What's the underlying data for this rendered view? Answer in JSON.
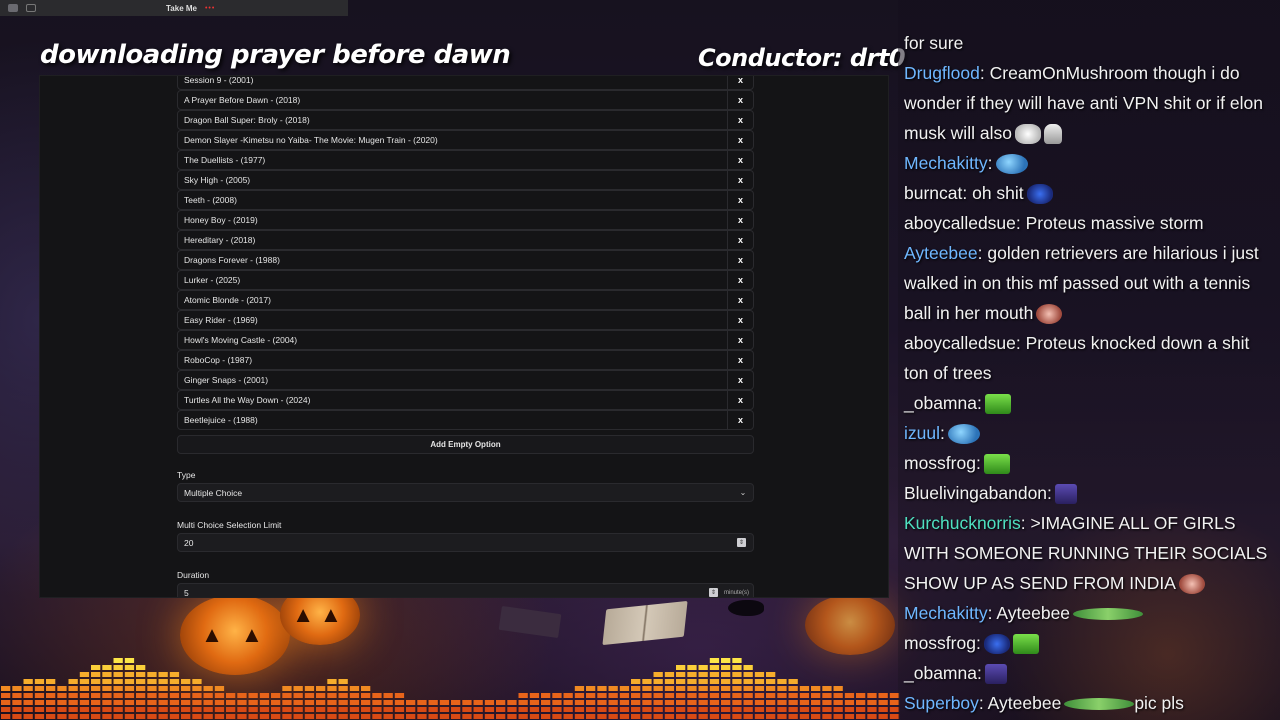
{
  "overlay": {
    "tab_name": "Take Me",
    "tab_dots": "•••",
    "stream_title": "downloading prayer before dawn",
    "conductor": "Conductor: drt0"
  },
  "poll": {
    "options": [
      "Session 9 - (2001)",
      "A Prayer Before Dawn - (2018)",
      "Dragon Ball Super: Broly - (2018)",
      "Demon Slayer -Kimetsu no Yaiba- The Movie: Mugen Train - (2020)",
      "The Duellists - (1977)",
      "Sky High - (2005)",
      "Teeth - (2008)",
      "Honey Boy - (2019)",
      "Hereditary - (2018)",
      "Dragons Forever - (1988)",
      "Lurker - (2025)",
      "Atomic Blonde - (2017)",
      "Easy Rider - (1969)",
      "Howl's Moving Castle - (2004)",
      "RoboCop - (1987)",
      "Ginger Snaps - (2001)",
      "Turtles All the Way Down - (2024)",
      "Beetlejuice - (1988)"
    ],
    "remove_label": "x",
    "add_empty_label": "Add Empty Option",
    "type_label": "Type",
    "type_value": "Multiple Choice",
    "limit_label": "Multi Choice Selection Limit",
    "limit_value": "20",
    "duration_label": "Duration",
    "duration_value": "5",
    "duration_unit": "minute(s)"
  },
  "chat": {
    "colors": {
      "blue": "#6fb7ff",
      "teal": "#4fe0c0",
      "white": "#f2f2f2"
    },
    "messages": [
      {
        "user": "",
        "text": "for sure",
        "color": "white",
        "emotes": []
      },
      {
        "user": "Drugflood",
        "text": ": CreamOnMushroom though i do wonder if they will have anti VPN shit or if elon musk will also",
        "color": "blue",
        "emotes": [
          "troll",
          "hand"
        ]
      },
      {
        "user": "Mechakitty",
        "text": ":",
        "color": "blue",
        "emotes": [
          "pepeblue"
        ]
      },
      {
        "user": "burncat",
        "text": ": oh shit",
        "color": "white",
        "emotes": [
          "cat"
        ]
      },
      {
        "user": "aboycalledsue",
        "text": ": Proteus massive storm",
        "color": "white",
        "emotes": []
      },
      {
        "user": "Ayteebee",
        "text": ": golden retrievers are hilarious i just walked in on this mf passed out with a tennis ball in her mouth",
        "color": "blue",
        "emotes": [
          "mouth"
        ]
      },
      {
        "user": "aboycalledsue",
        "text": ": Proteus knocked down a shit ton of trees",
        "color": "white",
        "emotes": []
      },
      {
        "user": "_obamna",
        "text": ":",
        "color": "white",
        "emotes": [
          "green"
        ]
      },
      {
        "user": "izuul",
        "text": ":",
        "color": "blue",
        "emotes": [
          "pepeblue"
        ]
      },
      {
        "user": "mossfrog",
        "text": ":",
        "color": "white",
        "emotes": [
          "green"
        ]
      },
      {
        "user": "Bluelivingabandon",
        "text": ":",
        "color": "white",
        "emotes": [
          "wiz"
        ]
      },
      {
        "user": "Kurchucknorris",
        "text": ": >IMAGINE ALL OF GIRLS WITH SOMEONE RUNNING THEIR SOCIALS SHOW UP AS SEND FROM INDIA",
        "color": "teal",
        "emotes": [
          "mouth"
        ]
      },
      {
        "user": "Mechakitty",
        "text": ": Ayteebee",
        "color": "blue",
        "emotes": [
          "longfrog"
        ]
      },
      {
        "user": "mossfrog",
        "text": ":",
        "color": "white",
        "emotes": [
          "cat",
          "green"
        ]
      },
      {
        "user": "_obamna",
        "text": ":",
        "color": "white",
        "emotes": [
          "wiz"
        ]
      },
      {
        "user": "Superboy",
        "text": ": Ayteebee",
        "color": "blue",
        "emotes": [
          "longfrog"
        ],
        "tail": "pic pls"
      }
    ]
  },
  "equalizer": {
    "levels": [
      5,
      5,
      6,
      6,
      6,
      5,
      6,
      7,
      8,
      8,
      9,
      9,
      8,
      7,
      7,
      7,
      6,
      6,
      5,
      5,
      4,
      4,
      4,
      4,
      4,
      5,
      5,
      5,
      5,
      6,
      6,
      5,
      5,
      4,
      4,
      4,
      3,
      3,
      3,
      3,
      3,
      3,
      3,
      3,
      3,
      3,
      4,
      4,
      4,
      4,
      4,
      5,
      5,
      5,
      5,
      5,
      6,
      6,
      7,
      7,
      8,
      8,
      8,
      9,
      9,
      9,
      8,
      7,
      7,
      6,
      6,
      5,
      5,
      5,
      5,
      4,
      4,
      4,
      4,
      4
    ],
    "colors": [
      "#d84a14",
      "#e8641a",
      "#f08a22",
      "#f6ad2c",
      "#fbd03a",
      "#fde648"
    ]
  }
}
